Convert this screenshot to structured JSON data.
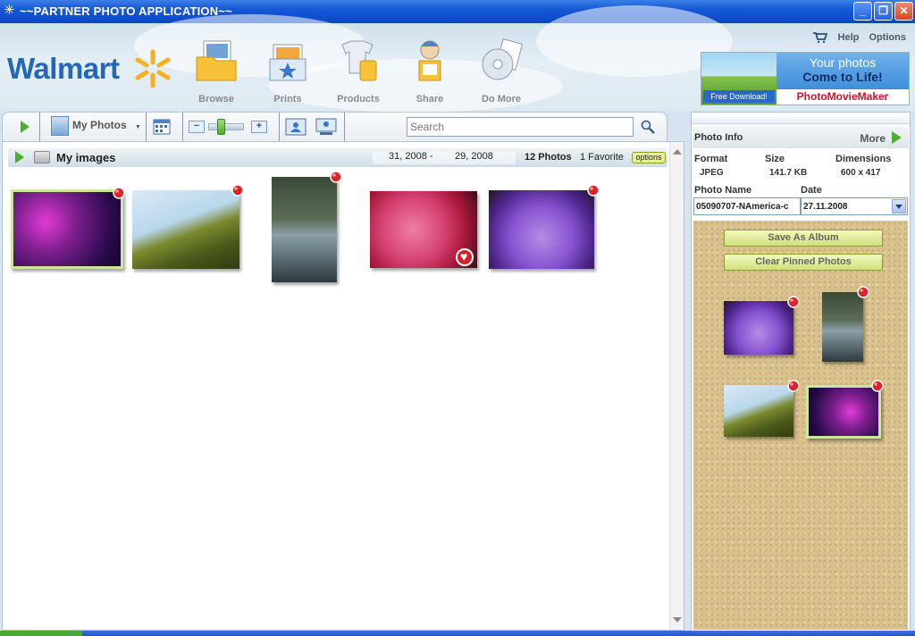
{
  "window": {
    "title": "~~PARTNER PHOTO APPLICATION~~"
  },
  "header": {
    "logo": "Walmart",
    "nav": [
      "Browse",
      "Prints",
      "Products",
      "Share",
      "Do More"
    ],
    "links": {
      "help": "Help",
      "options": "Options"
    }
  },
  "ad": {
    "line1": "Your photos",
    "line2": "Come to Life!",
    "free_download": "Free Download!",
    "brand": "PhotoMovieMaker"
  },
  "toolbar": {
    "album_label": "My Photos",
    "search_placeholder": "Search"
  },
  "group": {
    "name": "My images",
    "date_start": "31, 2008 -",
    "date_end": "29, 2008",
    "count": "12 Photos",
    "favorites": "1 Favorite",
    "options_label": "options"
  },
  "thumbnails": [
    {
      "subject": "galaxy",
      "selected": true,
      "pinned": true,
      "favorite": false
    },
    {
      "subject": "leaves",
      "selected": false,
      "pinned": true,
      "favorite": false
    },
    {
      "subject": "swan",
      "selected": false,
      "pinned": true,
      "favorite": false
    },
    {
      "subject": "pink flower",
      "selected": false,
      "pinned": false,
      "favorite": true
    },
    {
      "subject": "purple crocus",
      "selected": false,
      "pinned": true,
      "favorite": false
    }
  ],
  "photo_info": {
    "title": "Photo Info",
    "more": "More",
    "labels": {
      "format": "Format",
      "size": "Size",
      "dimensions": "Dimensions",
      "photo_name": "Photo Name",
      "date": "Date"
    },
    "format": "JPEG",
    "size": "141.7 KB",
    "dimensions": "600 x 417",
    "photo_name": "05090707-NAmerica-c",
    "date": "27.11.2008"
  },
  "corkboard": {
    "save_album": "Save As Album",
    "clear_pinned": "Clear Pinned Photos"
  },
  "colors": {
    "titlebar": "#0d47c4",
    "accent_green": "#4caf30",
    "walmart_blue": "#2367b8",
    "walmart_spark": "#f7b11e"
  }
}
